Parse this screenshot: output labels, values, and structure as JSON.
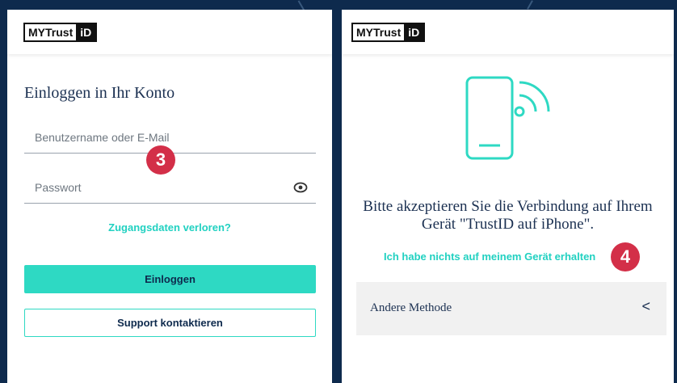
{
  "left_panel": {
    "logo_text": "MYTrust",
    "logo_id": "iD",
    "title": "Einloggen in Ihr Konto",
    "username_placeholder": "Benutzername oder E-Mail",
    "password_placeholder": "Passwort",
    "step_badge": "3",
    "forgot_link": "Zugangsdaten verloren?",
    "login_button": "Einloggen",
    "support_button": "Support kontaktieren"
  },
  "right_panel": {
    "logo_text": "MYTrust",
    "logo_id": "iD",
    "message": "Bitte akzeptieren Sie die Verbindung auf Ihrem Gerät \"TrustID auf iPhone\".",
    "no_notice_link": "Ich habe nichts auf meinem Gerät erhalten",
    "step_badge": "4",
    "other_method_label": "Andere Methode",
    "chevron": "<"
  },
  "colors": {
    "accent": "#2ed9c3",
    "link": "#21d1c1",
    "badge": "#d32f48",
    "navy": "#1c3152",
    "background": "#0e2a4d"
  },
  "icons": [
    "eye-icon",
    "phone-signal-icon",
    "chevron-left-icon"
  ]
}
